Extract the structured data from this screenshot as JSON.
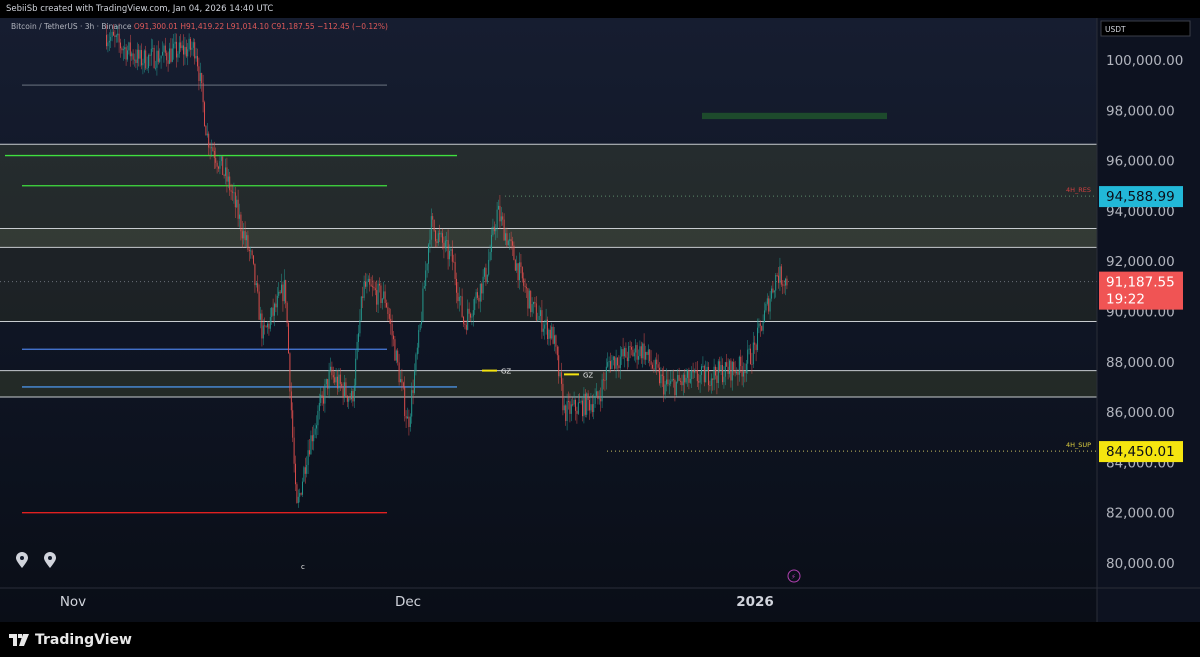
{
  "header": {
    "caption": "SebiiSb created with TradingView.com, Jan 04, 2026 14:40 UTC"
  },
  "legend": {
    "symbol": "Bitcoin / TetherUS · 3h · Binance",
    "open": "O91,300.01",
    "high": "H91,419.22",
    "low": "L91,014.10",
    "close": "C91,187.55",
    "change": "−112.45 (−0.12%)"
  },
  "price_axis": {
    "currency": "USDT",
    "ticks": [
      "100,000.00",
      "98,000.00",
      "96,000.00",
      "94,000.00",
      "92,000.00",
      "90,000.00",
      "88,000.00",
      "86,000.00",
      "84,000.00",
      "82,000.00",
      "80,000.00"
    ]
  },
  "time_axis": {
    "ticks": [
      "Nov",
      "Dec",
      "2026"
    ]
  },
  "markers": {
    "res_label": "4H_RES",
    "res_price": "94,588.99",
    "sup_label": "4H_SUP",
    "sup_price": "84,450.01",
    "last_price": "91,187.55",
    "countdown": "19:22",
    "gz": "GZ",
    "c": "c"
  },
  "footer": {
    "brand": "TradingView"
  },
  "colors": {
    "up": "#26a69a",
    "down": "#ef5350",
    "res": "#22b8d8",
    "sup": "#f5e50f",
    "last": "#f05454"
  },
  "chart_data": {
    "type": "candlestick",
    "interval": "3h",
    "ylim": [
      79000,
      101500
    ],
    "xlim": [
      "2025-10-29",
      "2026-01-31"
    ],
    "grid": false,
    "close_path": [
      [
        "2025-11-04",
        101000
      ],
      [
        "2025-11-07",
        100000
      ],
      [
        "2025-11-12",
        100500
      ],
      [
        "2025-11-13",
        97000
      ],
      [
        "2025-11-15",
        95000
      ],
      [
        "2025-11-17",
        92000
      ],
      [
        "2025-11-18",
        89000
      ],
      [
        "2025-11-20",
        91000
      ],
      [
        "2025-11-21",
        82000
      ],
      [
        "2025-11-22",
        84500
      ],
      [
        "2025-11-24",
        87500
      ],
      [
        "2025-11-26",
        86500
      ],
      [
        "2025-11-27",
        91000
      ],
      [
        "2025-11-29",
        90500
      ],
      [
        "2025-12-01",
        85500
      ],
      [
        "2025-12-02",
        89000
      ],
      [
        "2025-12-03",
        93500
      ],
      [
        "2025-12-05",
        92000
      ],
      [
        "2025-12-06",
        89500
      ],
      [
        "2025-12-08",
        91500
      ],
      [
        "2025-12-09",
        94000
      ],
      [
        "2025-12-11",
        91500
      ],
      [
        "2025-12-12",
        90200
      ],
      [
        "2025-12-14",
        89000
      ],
      [
        "2025-12-15",
        86000
      ],
      [
        "2025-12-18",
        86500
      ],
      [
        "2025-12-19",
        88000
      ],
      [
        "2025-12-22",
        88500
      ],
      [
        "2025-12-24",
        87000
      ],
      [
        "2025-12-28",
        87500
      ],
      [
        "2025-12-31",
        87800
      ],
      [
        "2026-01-01",
        88500
      ],
      [
        "2026-01-02",
        90000
      ],
      [
        "2026-01-03",
        91500
      ],
      [
        "2026-01-04",
        91187.55
      ]
    ],
    "levels": [
      {
        "price": 99000,
        "color": "#5a6270"
      },
      {
        "price": 96200,
        "color": "#3fe03f"
      },
      {
        "price": 95000,
        "color": "#3fe03f"
      },
      {
        "price": 88500,
        "color": "#4a7de0"
      },
      {
        "price": 87000,
        "color": "#4a90e0"
      },
      {
        "price": 82000,
        "color": "#e02020"
      }
    ],
    "zone_lines": [
      96650,
      93300,
      92550,
      89600,
      87650,
      86600
    ],
    "zones": [
      [
        96650,
        93300
      ],
      [
        93300,
        92550
      ],
      [
        92550,
        89600
      ],
      [
        87650,
        86600
      ]
    ],
    "box": [
      97900,
      97650
    ],
    "resistance": 94588.99,
    "support": 84450.01,
    "last": 91187.55
  }
}
